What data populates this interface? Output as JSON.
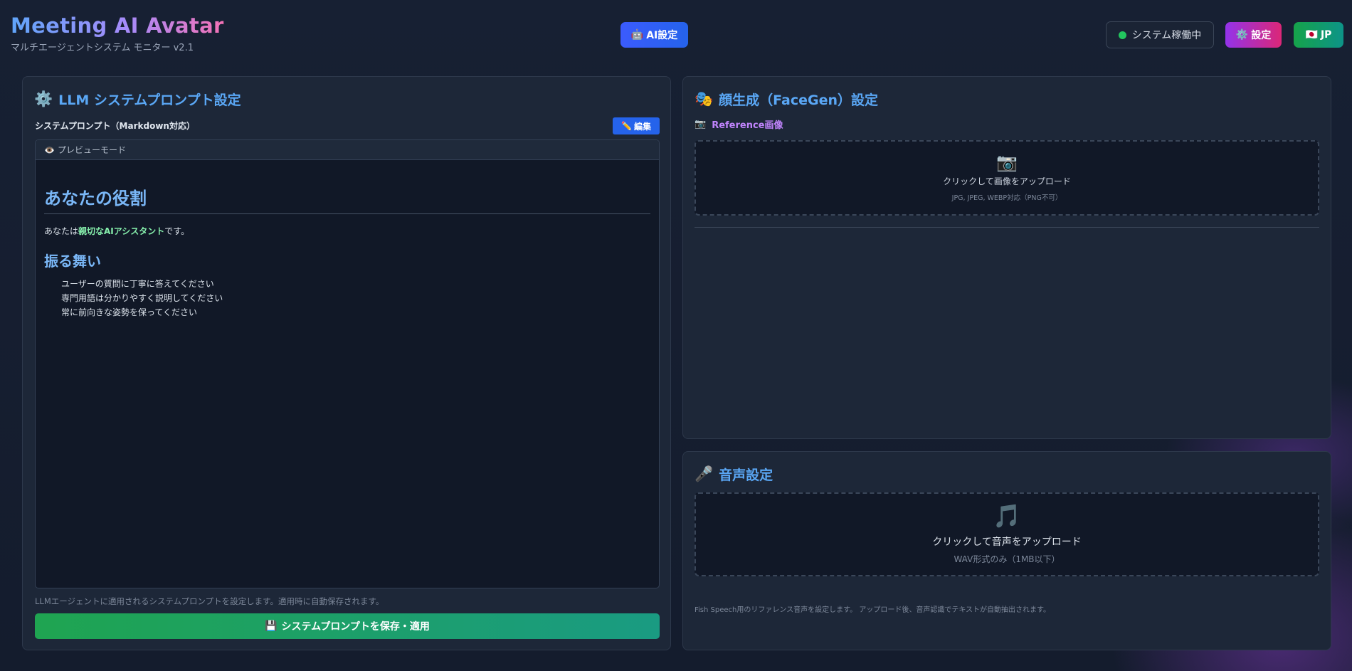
{
  "header": {
    "title": "Meeting AI Avatar",
    "subtitle": "マルチエージェントシステム モニター v2.1",
    "ai_button": {
      "icon": "🤖",
      "label": "AI設定"
    },
    "status": {
      "label": "システム稼働中",
      "color": "#22c55e"
    },
    "settings_button": {
      "icon": "⚙️",
      "label": "設定"
    },
    "lang_button": {
      "icon": "🇯🇵",
      "label": "JP"
    }
  },
  "llm_panel": {
    "icon": "⚙️",
    "title": "LLM システムプロンプト設定",
    "prompt_label": "システムプロンプト（Markdown対応）",
    "edit_button": {
      "icon": "✏️",
      "label": "編集"
    },
    "preview_mode": {
      "icon": "👁️",
      "label": "プレビューモード"
    },
    "markdown": {
      "h1": "あなたの役割",
      "p_prefix": "あなたは",
      "p_strong": "親切なAIアシスタント",
      "p_suffix": "です。",
      "h2": "振る舞い",
      "items": [
        "ユーザーの質問に丁寧に答えてください",
        "専門用語は分かりやすく説明してください",
        "常に前向きな姿勢を保ってください"
      ]
    },
    "help_text": "LLMエージェントに適用されるシステムプロンプトを設定します。適用時に自動保存されます。",
    "save_button": {
      "icon": "💾",
      "label": "システムプロンプトを保存・適用"
    }
  },
  "face_panel": {
    "icon": "🎭",
    "title": "顔生成（FaceGen）設定",
    "reference_label": {
      "icon": "📷",
      "label": "Reference画像"
    },
    "upload": {
      "icon": "📷",
      "main": "クリックして画像をアップロード",
      "sub": "JPG, JPEG, WEBP対応（PNG不可）"
    }
  },
  "voice_panel": {
    "icon": "🎤",
    "title": "音声設定",
    "upload": {
      "icon": "🎵",
      "main": "クリックして音声をアップロード",
      "sub": "WAV形式のみ（1MB以下）"
    },
    "help_text": "Fish Speech用のリファレンス音声を設定します。 アップロード後、音声認識でテキストが自動抽出されます。"
  }
}
